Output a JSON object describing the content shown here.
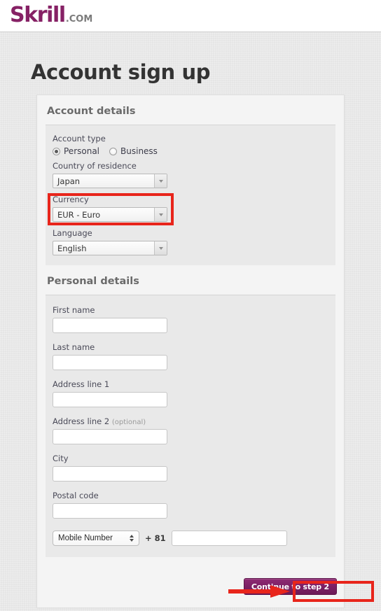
{
  "header": {
    "logo_mark": "Skrill",
    "logo_tld": ".COM",
    "brand_color": "#862165"
  },
  "page": {
    "title": "Account sign up",
    "background_color": "#e8e8e8"
  },
  "account_details": {
    "section_title": "Account details",
    "account_type": {
      "label": "Account type",
      "options": [
        {
          "label": "Personal",
          "checked": true
        },
        {
          "label": "Business",
          "checked": false
        }
      ]
    },
    "country": {
      "label": "Country of residence",
      "value": "Japan"
    },
    "currency": {
      "label": "Currency",
      "value": "EUR - Euro",
      "highlighted": true
    },
    "language": {
      "label": "Language",
      "value": "English"
    }
  },
  "personal_details": {
    "section_title": "Personal details",
    "fields": [
      {
        "label": "First name",
        "optional": "",
        "value": ""
      },
      {
        "label": "Last name",
        "optional": "",
        "value": ""
      },
      {
        "label": "Address line 1",
        "optional": "",
        "value": ""
      },
      {
        "label": "Address line 2",
        "optional": "(optional)",
        "value": ""
      },
      {
        "label": "City",
        "optional": "",
        "value": ""
      },
      {
        "label": "Postal code",
        "optional": "",
        "value": ""
      }
    ],
    "phone": {
      "type_value": "Mobile Number",
      "dial_code": "+ 81",
      "number_value": ""
    }
  },
  "footer": {
    "continue_label": "Continue to step 2"
  },
  "annotations": {
    "color": "#e8251b",
    "currency_box": "red-rectangle-around-currency",
    "button_box": "red-rectangle-around-continue-button",
    "arrow": "red-arrow-pointing-right-at-continue-button"
  }
}
